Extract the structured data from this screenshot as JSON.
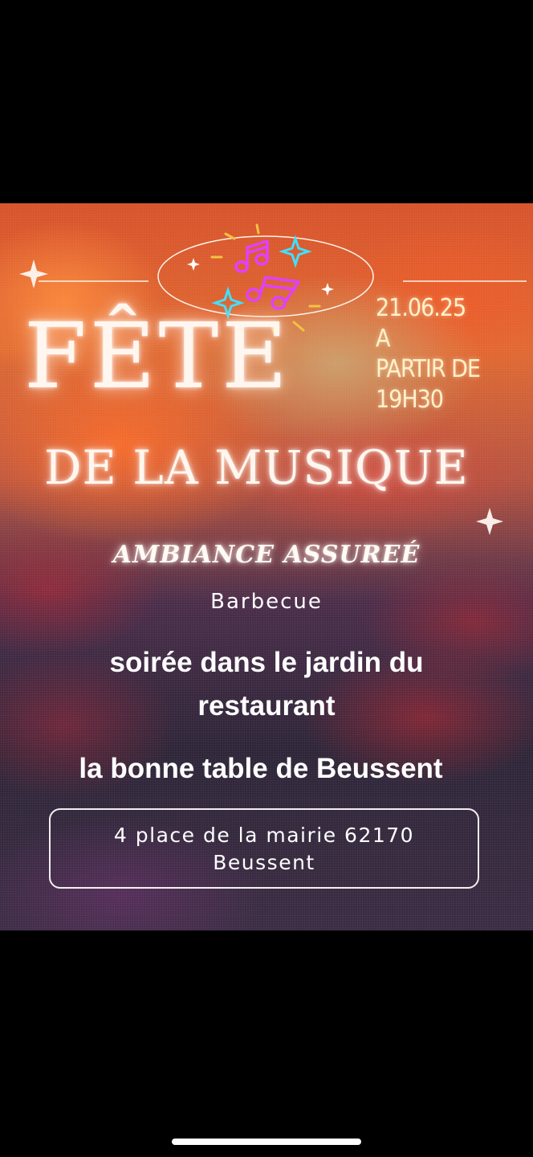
{
  "poster": {
    "title_line1": "FÊTE",
    "title_line2": "DE LA MUSIQUE",
    "date": "21.06.25",
    "time_line1": "A",
    "time_line2": "PARTIR DE",
    "time_line3": "19H30",
    "tagline": "AMBIANCE ASSUREÉ",
    "subtitle": "Barbecue",
    "description": "soirée dans le jardin du restaurant",
    "venue": "la bonne table de Beussent",
    "address_line1": "4 place de la mairie 62170",
    "address_line2": "Beussent"
  },
  "icons": {
    "music_notes": "music-notes-icon",
    "sparkles": "sparkle-icon"
  },
  "colors": {
    "background": "#000000",
    "accent_magenta": "#e040ff",
    "accent_cyan": "#3fe0ff",
    "accent_yellow": "#f5c242",
    "date_text": "#fff1c9"
  }
}
